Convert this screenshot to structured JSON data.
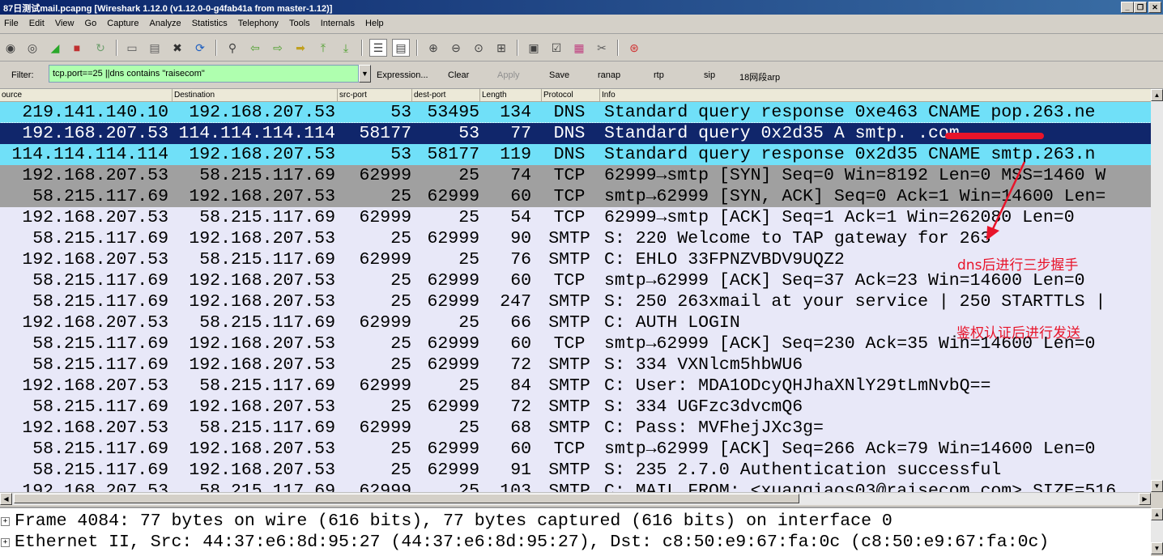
{
  "window": {
    "title": "87日测试mail.pcapng  [Wireshark 1.12.0  (v1.12.0-0-g4fab41a from master-1.12)]",
    "controls": [
      "_",
      "❐",
      "✕"
    ]
  },
  "menu": [
    "File",
    "Edit",
    "View",
    "Go",
    "Capture",
    "Analyze",
    "Statistics",
    "Telephony",
    "Tools",
    "Internals",
    "Help"
  ],
  "filter": {
    "label": "Filter:",
    "value": "tcp.port==25 ||dns  contains  \"raisecom\"",
    "buttons": [
      {
        "label": "Expression...",
        "enabled": true
      },
      {
        "label": "Clear",
        "enabled": true
      },
      {
        "label": "Apply",
        "enabled": false
      },
      {
        "label": "Save",
        "enabled": true
      },
      {
        "label": "ranap",
        "enabled": true
      },
      {
        "label": "rtp",
        "enabled": true
      },
      {
        "label": "sip",
        "enabled": true
      },
      {
        "label": "18网段arp",
        "enabled": true
      }
    ]
  },
  "columns": [
    "ource",
    "Destination",
    "src-port",
    "dest-port",
    "Length",
    "Protocol",
    "Info"
  ],
  "packets": [
    {
      "src": "219.141.140.10",
      "dst": "192.168.207.53",
      "sport": "53",
      "dport": "53495",
      "len": "134",
      "proto": "DNS",
      "info": "Standard query response 0xe463  CNAME pop.263.ne",
      "style": "dns"
    },
    {
      "src": "192.168.207.53",
      "dst": "114.114.114.114",
      "sport": "58177",
      "dport": "53",
      "len": "77",
      "proto": "DNS",
      "info": "Standard query 0x2d35  A smtp.           .com",
      "style": "selected"
    },
    {
      "src": "114.114.114.114",
      "dst": "192.168.207.53",
      "sport": "53",
      "dport": "58177",
      "len": "119",
      "proto": "DNS",
      "info": "Standard query response 0x2d35  CNAME smtp.263.n",
      "style": "dns"
    },
    {
      "src": "192.168.207.53",
      "dst": "58.215.117.69",
      "sport": "62999",
      "dport": "25",
      "len": "74",
      "proto": "TCP",
      "info": "62999→smtp [SYN] Seq=0 Win=8192 Len=0 MSS=1460 W",
      "style": "syn"
    },
    {
      "src": "58.215.117.69",
      "dst": "192.168.207.53",
      "sport": "25",
      "dport": "62999",
      "len": "60",
      "proto": "TCP",
      "info": "smtp→62999 [SYN, ACK] Seq=0 Ack=1 Win=14600 Len=",
      "style": "syn"
    },
    {
      "src": "192.168.207.53",
      "dst": "58.215.117.69",
      "sport": "62999",
      "dport": "25",
      "len": "54",
      "proto": "TCP",
      "info": "62999→smtp [ACK] Seq=1 Ack=1 Win=262080 Len=0",
      "style": "tcp"
    },
    {
      "src": "58.215.117.69",
      "dst": "192.168.207.53",
      "sport": "25",
      "dport": "62999",
      "len": "90",
      "proto": "SMTP",
      "info": "S: 220 Welcome to TAP gateway for 263",
      "style": "tcp"
    },
    {
      "src": "192.168.207.53",
      "dst": "58.215.117.69",
      "sport": "62999",
      "dport": "25",
      "len": "76",
      "proto": "SMTP",
      "info": "C: EHLO 33FPNZVBDV9UQZ2",
      "style": "tcp"
    },
    {
      "src": "58.215.117.69",
      "dst": "192.168.207.53",
      "sport": "25",
      "dport": "62999",
      "len": "60",
      "proto": "TCP",
      "info": "smtp→62999 [ACK] Seq=37 Ack=23 Win=14600 Len=0",
      "style": "tcp"
    },
    {
      "src": "58.215.117.69",
      "dst": "192.168.207.53",
      "sport": "25",
      "dport": "62999",
      "len": "247",
      "proto": "SMTP",
      "info": "S: 250 263xmail at your service | 250 STARTTLS |",
      "style": "tcp"
    },
    {
      "src": "192.168.207.53",
      "dst": "58.215.117.69",
      "sport": "62999",
      "dport": "25",
      "len": "66",
      "proto": "SMTP",
      "info": "C: AUTH LOGIN",
      "style": "tcp"
    },
    {
      "src": "58.215.117.69",
      "dst": "192.168.207.53",
      "sport": "25",
      "dport": "62999",
      "len": "60",
      "proto": "TCP",
      "info": "smtp→62999 [ACK] Seq=230 Ack=35 Win=14600 Len=0",
      "style": "tcp"
    },
    {
      "src": "58.215.117.69",
      "dst": "192.168.207.53",
      "sport": "25",
      "dport": "62999",
      "len": "72",
      "proto": "SMTP",
      "info": "S: 334 VXNlcm5hbWU6",
      "style": "tcp"
    },
    {
      "src": "192.168.207.53",
      "dst": "58.215.117.69",
      "sport": "62999",
      "dport": "25",
      "len": "84",
      "proto": "SMTP",
      "info": "C: User: MDA1ODcyQHJhaXNlY29tLmNvbQ==",
      "style": "tcp"
    },
    {
      "src": "58.215.117.69",
      "dst": "192.168.207.53",
      "sport": "25",
      "dport": "62999",
      "len": "72",
      "proto": "SMTP",
      "info": "S: 334 UGFzc3dvcmQ6",
      "style": "tcp"
    },
    {
      "src": "192.168.207.53",
      "dst": "58.215.117.69",
      "sport": "62999",
      "dport": "25",
      "len": "68",
      "proto": "SMTP",
      "info": "C: Pass: MVFhejJXc3g=",
      "style": "tcp"
    },
    {
      "src": "58.215.117.69",
      "dst": "192.168.207.53",
      "sport": "25",
      "dport": "62999",
      "len": "60",
      "proto": "TCP",
      "info": "smtp→62999 [ACK] Seq=266 Ack=79 Win=14600 Len=0",
      "style": "tcp"
    },
    {
      "src": "58.215.117.69",
      "dst": "192.168.207.53",
      "sport": "25",
      "dport": "62999",
      "len": "91",
      "proto": "SMTP",
      "info": "S: 235 2.7.0 Authentication successful",
      "style": "tcp"
    },
    {
      "src": "192.168.207.53",
      "dst": "58.215.117.69",
      "sport": "62999",
      "dport": "25",
      "len": "103",
      "proto": "SMTP",
      "info": "C: MAIL FROM: <xuanqiaos03@raisecom.com> SIZE=516",
      "style": "tcp"
    }
  ],
  "details": [
    {
      "expander": "+",
      "text": "Frame 4084: 77 bytes on wire (616 bits), 77 bytes captured (616 bits) on interface 0"
    },
    {
      "expander": "+",
      "text": "Ethernet II, Src: 44:37:e6:8d:95:27 (44:37:e6:8d:95:27), Dst: c8:50:e9:67:fa:0c (c8:50:e9:67:fa:0c)"
    }
  ],
  "annotations": {
    "dns_handshake": "dns后进行三步握手",
    "auth_send": "鉴权认证后进行发送"
  },
  "colors": {
    "dns_row_bg": "#70e0f8",
    "selected_row_bg": "#10266b",
    "syn_row_bg": "#a0a0a0",
    "tcp_row_bg": "#e8e8f8",
    "annotation": "#e8142a",
    "filter_bg": "#afffaf"
  },
  "toolbar_icons": [
    "interface-list-icon",
    "capture-options-icon",
    "start-capture-icon",
    "stop-capture-icon",
    "restart-capture-icon",
    "open-file-icon",
    "save-file-icon",
    "close-file-icon",
    "reload-file-icon",
    "find-packet-icon",
    "go-back-icon",
    "go-forward-icon",
    "go-to-packet-icon",
    "go-first-icon",
    "go-last-icon",
    "colorize-icon",
    "auto-scroll-icon",
    "zoom-in-icon",
    "zoom-out-icon",
    "zoom-normal-icon",
    "resize-columns-icon",
    "capture-filters-icon",
    "display-filters-icon",
    "coloring-rules-icon",
    "preferences-icon",
    "help-icon"
  ]
}
